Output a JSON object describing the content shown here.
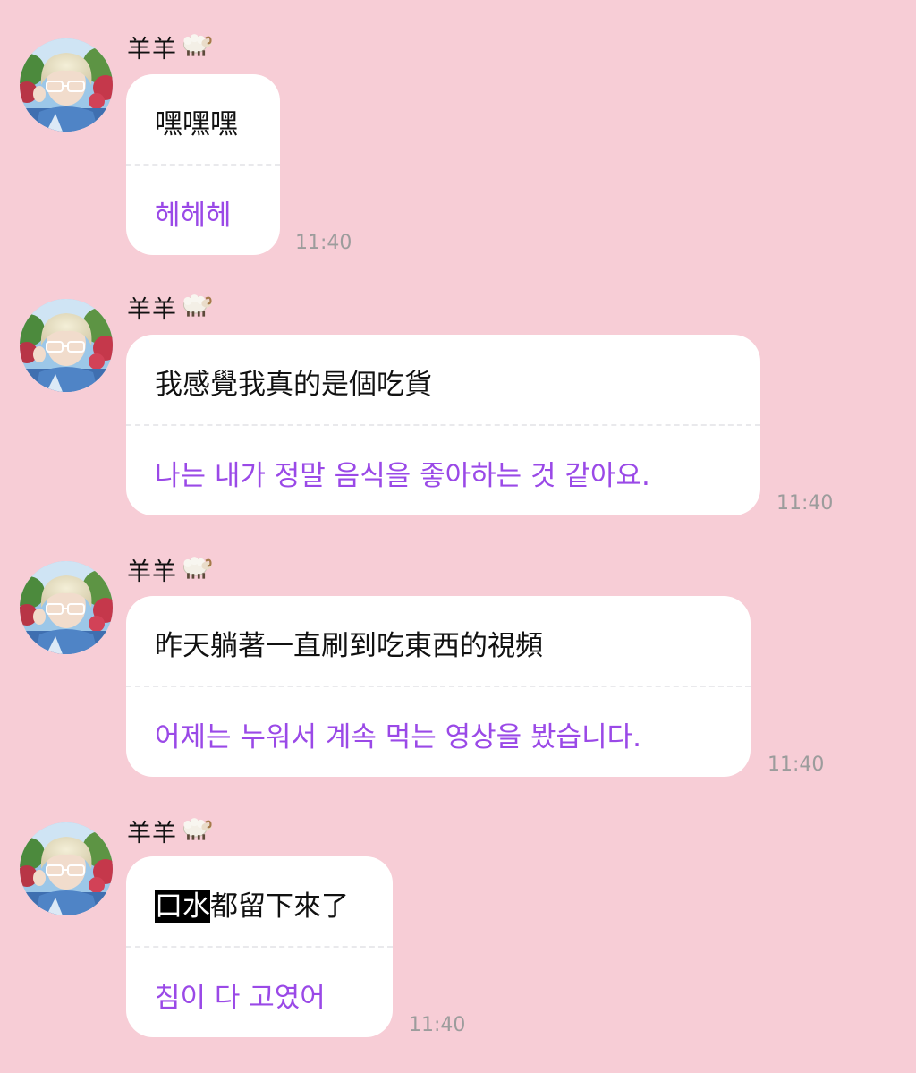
{
  "messages": [
    {
      "sender": "羊羊",
      "sender_emoji": "🐏",
      "original": "嘿嘿嘿",
      "translation": "헤헤헤",
      "time": "11:40"
    },
    {
      "sender": "羊羊",
      "sender_emoji": "🐏",
      "original": "我感覺我真的是個吃貨",
      "translation": "나는 내가 정말 음식을 좋아하는 것 같아요.",
      "time": "11:40"
    },
    {
      "sender": "羊羊",
      "sender_emoji": "🐏",
      "original": "昨天躺著一直刷到吃東西的視頻",
      "translation": "어제는 누워서 계속 먹는 영상을 봤습니다.",
      "time": "11:40"
    },
    {
      "sender": "羊羊",
      "sender_emoji": "🐏",
      "original_highlight": "口水",
      "original_rest": "都留下來了",
      "translation": "침이 다 고였어",
      "time": "11:40"
    }
  ],
  "colors": {
    "background": "#f7cdd6",
    "bubble": "#ffffff",
    "translation_text": "#9a49e7",
    "timestamp": "#9c9c9c",
    "highlight": "#000000"
  },
  "icons": {
    "sender_emoji": "ram-emoji",
    "avatar": "user-avatar-photo"
  }
}
